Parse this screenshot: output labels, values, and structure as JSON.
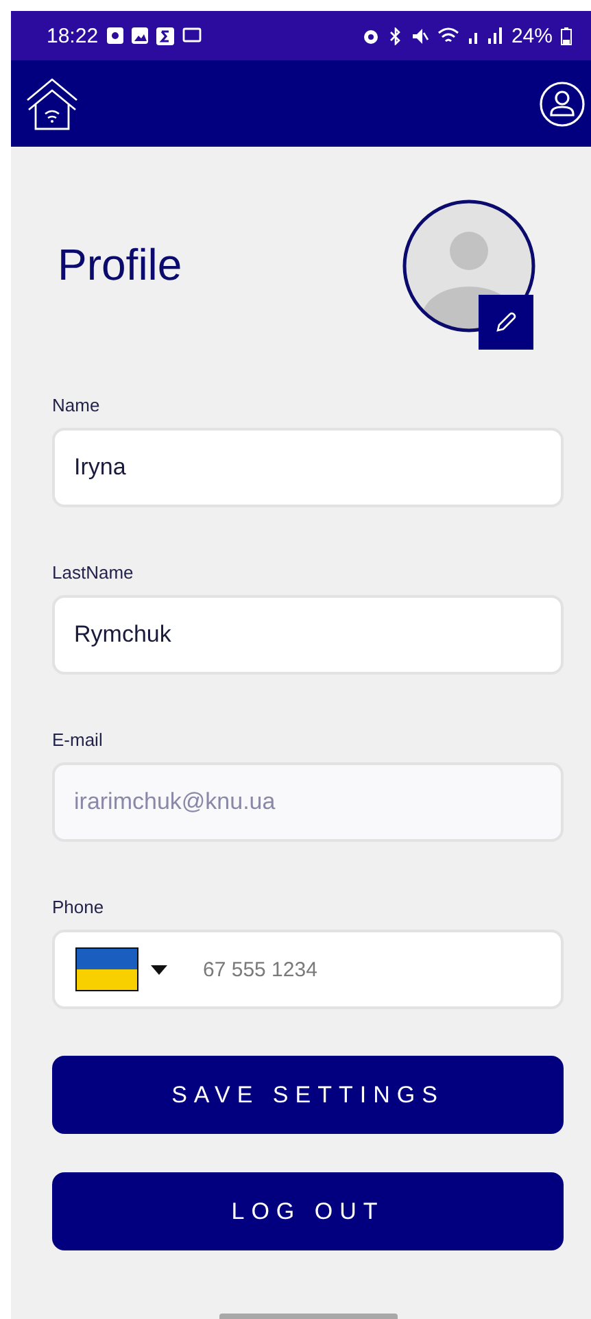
{
  "status_bar": {
    "time": "18:22",
    "battery": "24%"
  },
  "title": "Profile",
  "fields": [
    {
      "kind": "text",
      "label": "Name",
      "value": "Iryna",
      "disabled": false
    },
    {
      "kind": "text",
      "label": "LastName",
      "value": "Rymchuk",
      "disabled": false
    },
    {
      "kind": "text",
      "label": "E-mail",
      "value": "irarimchuk@knu.ua",
      "disabled": true
    },
    {
      "kind": "phone",
      "label": "Phone",
      "placeholder": "67 555 1234"
    }
  ],
  "buttons": [
    "SAVE SETTINGS",
    "LOG OUT"
  ]
}
